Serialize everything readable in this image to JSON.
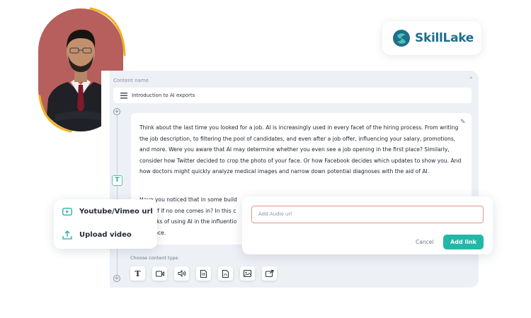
{
  "brand": {
    "name": "SkillLake",
    "color": "#1f6e8c"
  },
  "editor": {
    "content_name_label": "Content name",
    "collapse_icon": "chevron-up-icon",
    "title_icon": "list-icon",
    "title": "Introduction to AI exports",
    "edit_icon": "pencil-icon",
    "paragraph_1": "Think about the last time you looked for a job. AI is increasingly used in every facet of the hiring process. From writing the job description, to filtering the pool of candidates, and even after a job offer, influencing your salary, promotions, and more. Were you aware that AI may determine whether you even see a job opening in the first place? Similarly, consider how Twitter decided to crop the photo of your face. Or how Facebook decides which updates to show you. And how doctors might quickly analyze medical images and narrow down potential diagnoses with the aid of AI.",
    "paragraph_2_line_1": "Have you noticed that in some build",
    "paragraph_2_line_2": "turn off if no one comes in? In this c",
    "paragraph_2_line_3": "the risks of using AI in the influentio",
    "paragraph_2_line_4": "influence.",
    "text_block_badge": "T",
    "choose_content_type_label": "Choose content type",
    "content_types": [
      "text",
      "video",
      "audio",
      "document",
      "pdf",
      "image",
      "embed"
    ]
  },
  "media_menu": {
    "items": [
      {
        "label": "Youtube/Vimeo url",
        "icon": "play-icon"
      },
      {
        "label": "Upload video",
        "icon": "upload-icon"
      }
    ]
  },
  "audio_dialog": {
    "placeholder": "Add Audio url",
    "cancel_label": "Cancel",
    "add_label": "Add link",
    "accent_color": "#22b8a7",
    "error_border_color": "#e4938d"
  }
}
